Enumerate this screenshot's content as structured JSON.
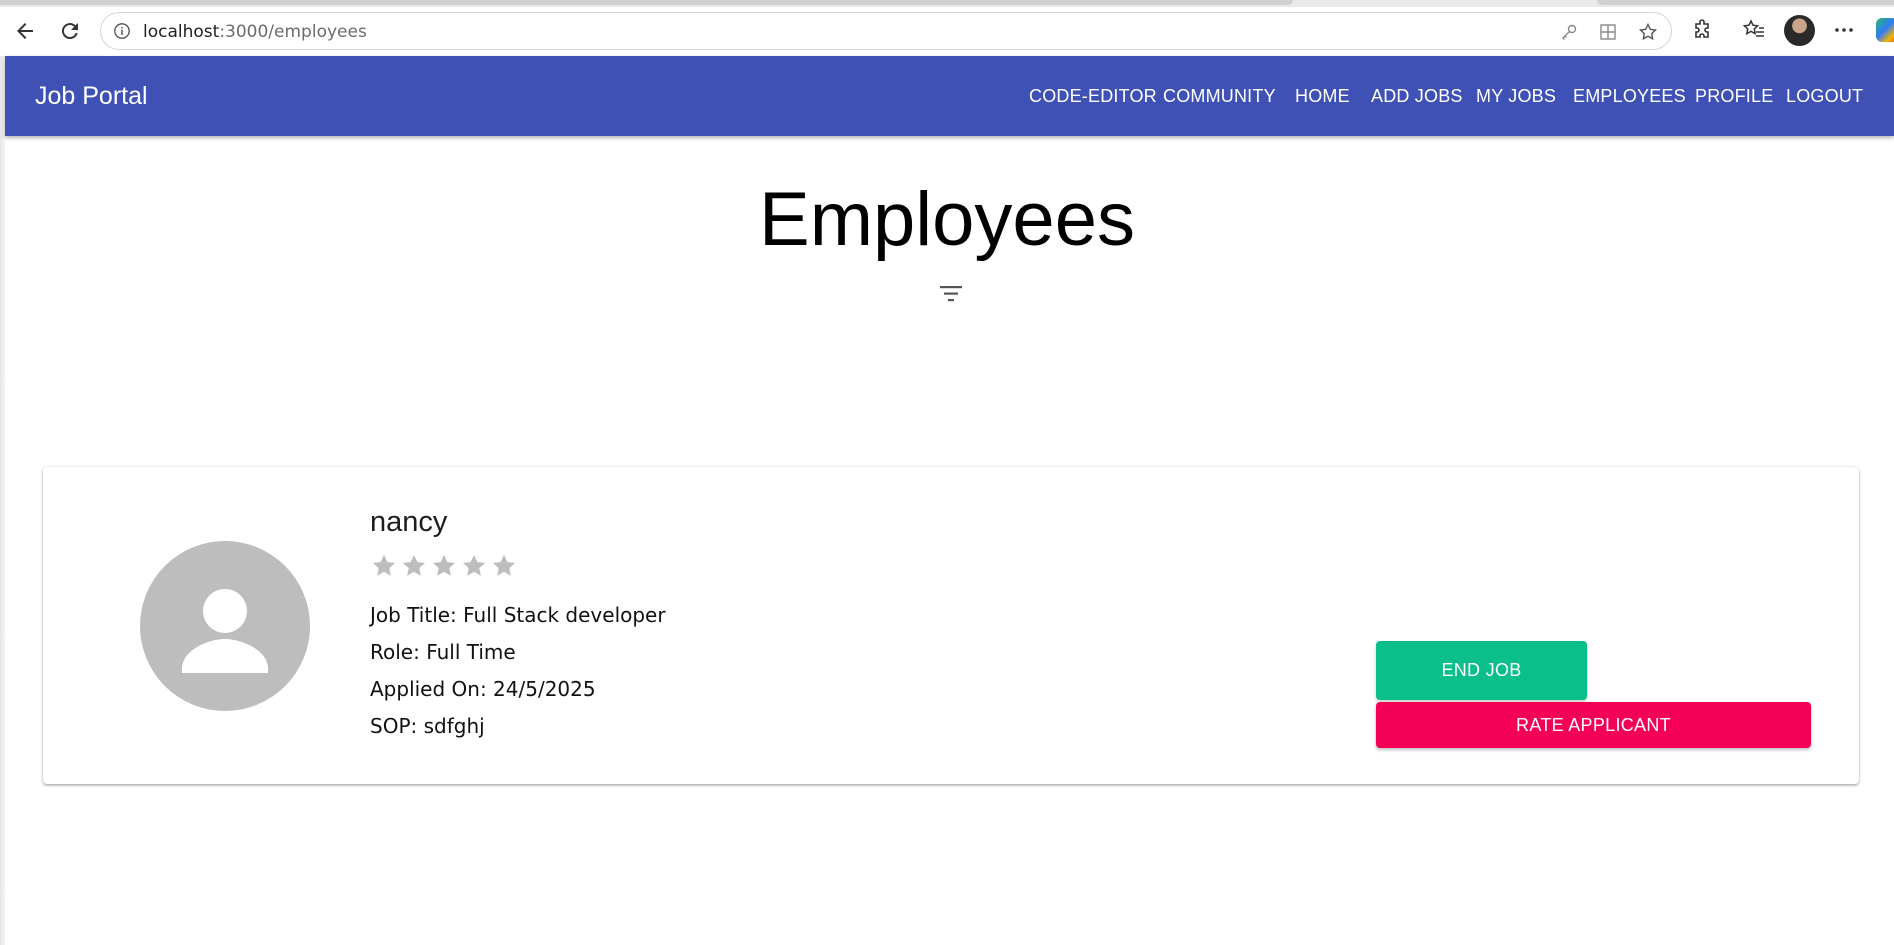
{
  "browser": {
    "url_host": "localhost",
    "url_path": ":3000/employees"
  },
  "navbar": {
    "brand": "Job Portal",
    "links": [
      {
        "label": "CODE-EDITOR"
      },
      {
        "label": "COMMUNITY"
      },
      {
        "label": "HOME"
      },
      {
        "label": "ADD JOBS"
      },
      {
        "label": "MY JOBS"
      },
      {
        "label": "EMPLOYEES"
      },
      {
        "label": "PROFILE"
      },
      {
        "label": "LOGOUT"
      }
    ],
    "color": "#3f51b5"
  },
  "page": {
    "title": "Employees"
  },
  "employee": {
    "name": "nancy",
    "rating": 0,
    "rating_max": 5,
    "job_title": "Job Title: Full Stack developer",
    "role": "Role: Full Time",
    "applied_on": "Applied On: 24/5/2025",
    "sop": "SOP: sdfghj",
    "end_job_label": "END JOB",
    "rate_label": "RATE APPLICANT",
    "end_job_color": "#0abf8a",
    "rate_color": "#f50057"
  },
  "icons": {
    "filter": "filter-list-icon",
    "avatar": "person-icon",
    "star": "star-icon"
  }
}
